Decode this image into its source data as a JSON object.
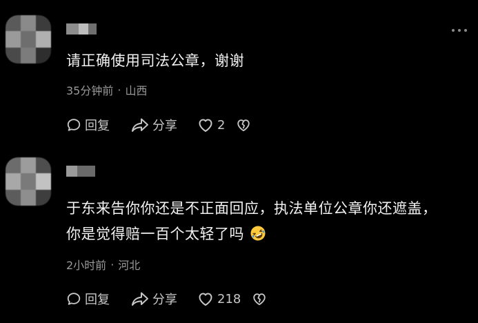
{
  "colors": {
    "background": "#000000",
    "text_primary": "#F2F2F2",
    "text_secondary": "#9A9A9A",
    "icon": "#C8C8C8",
    "emoji_yellow": "#FFC83D",
    "emoji_blue": "#3B9BE8"
  },
  "comments": [
    {
      "avatar_colors": [
        "#5a5a5a",
        "#8a8a8a",
        "#3c3c3c",
        "#9a9a9a",
        "#6e6e6e",
        "#b0b0b0",
        "#4a4a4a",
        "#7c7c7c",
        "#2e2e2e"
      ],
      "username_censored": true,
      "username_colors": [
        "#8c8c8c",
        "#bdbdbd",
        "#6f6f6f"
      ],
      "text_lines": [
        "请正确使用司法公章，谢谢"
      ],
      "emoji": null,
      "time": "35分钟前",
      "separator": "·",
      "location": "山西",
      "reply_label": "回复",
      "share_label": "分享",
      "like_count": "2",
      "reply_icon": "speech-bubble-icon",
      "share_icon": "share-arrow-icon",
      "like_icon": "heart-icon",
      "dislike_icon": "broken-heart-icon"
    },
    {
      "avatar_colors": [
        "#6c6c6c",
        "#9c9c9c",
        "#4e4e4e",
        "#a8a8a8",
        "#7a7a7a",
        "#c2c2c2",
        "#5c5c5c",
        "#8e8e8e",
        "#3e3e3e"
      ],
      "username_censored": true,
      "username_colors": [
        "#9a9a9a",
        "#6a6a6a"
      ],
      "text_lines": [
        "于东来告你你还是不正面回应，执法单位公章你还遮盖，",
        "你是觉得赔一百个太轻了吗"
      ],
      "emoji": "rolling-on-floor-laughing-emoji",
      "time": "2小时前",
      "separator": "·",
      "location": "河北",
      "reply_label": "回复",
      "share_label": "分享",
      "like_count": "218",
      "reply_icon": "speech-bubble-icon",
      "share_icon": "share-arrow-icon",
      "like_icon": "heart-icon",
      "dislike_icon": "broken-heart-icon"
    }
  ],
  "more_menu_icon": "more-dots-icon"
}
